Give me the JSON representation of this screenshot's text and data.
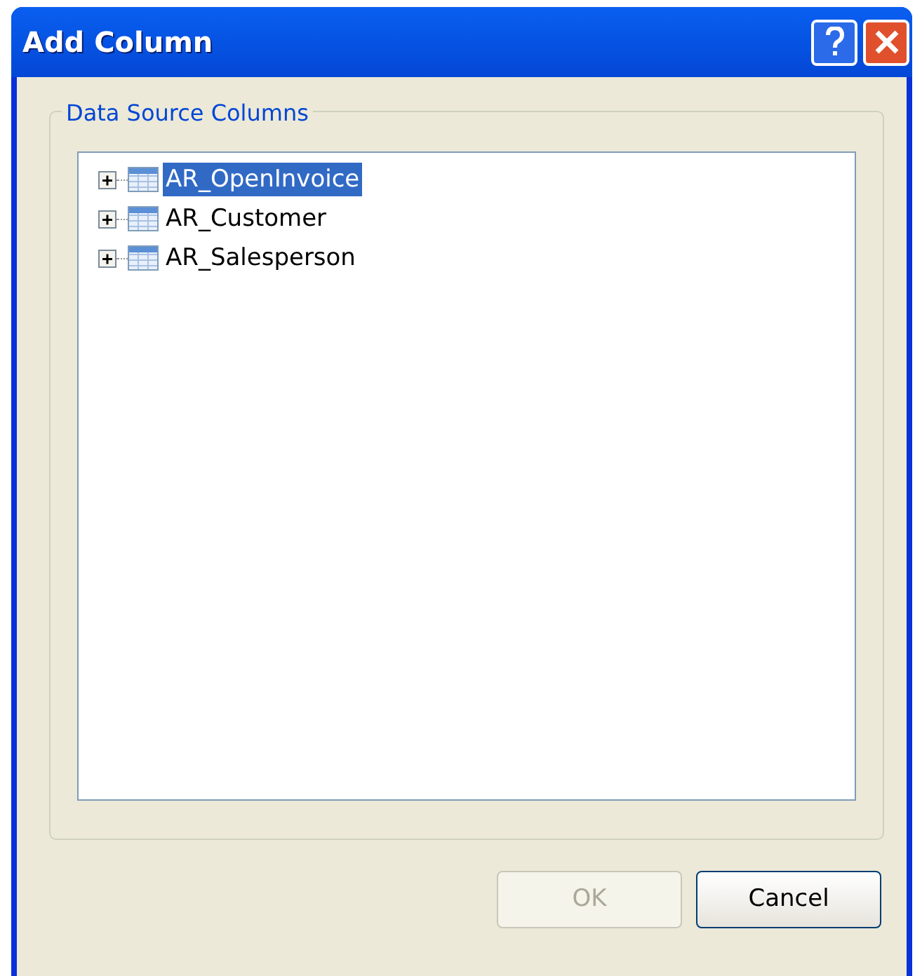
{
  "window": {
    "title": "Add Column"
  },
  "group": {
    "label": "Data Source Columns"
  },
  "tree": [
    {
      "label": "AR_OpenInvoice",
      "selected": true,
      "expanded": false
    },
    {
      "label": "AR_Customer",
      "selected": false,
      "expanded": false
    },
    {
      "label": "AR_Salesperson",
      "selected": false,
      "expanded": false
    }
  ],
  "buttons": [
    {
      "label": "OK",
      "disabled": true
    },
    {
      "label": "Cancel",
      "disabled": false
    }
  ]
}
